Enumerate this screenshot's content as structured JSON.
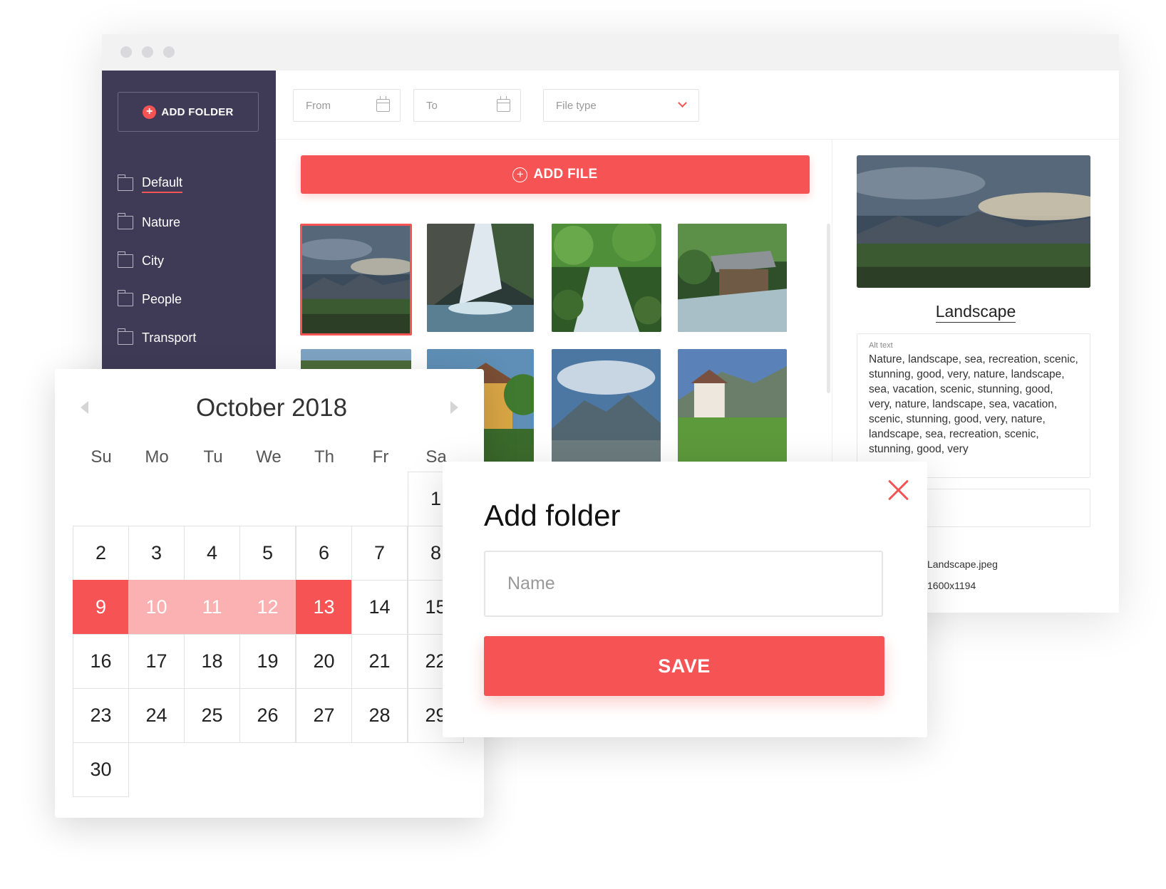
{
  "sidebar": {
    "add_folder_label": "ADD FOLDER",
    "folders": [
      {
        "label": "Default",
        "active": true
      },
      {
        "label": "Nature",
        "active": false
      },
      {
        "label": "City",
        "active": false
      },
      {
        "label": "People",
        "active": false
      },
      {
        "label": "Transport",
        "active": false
      }
    ]
  },
  "filters": {
    "from_placeholder": "From",
    "to_placeholder": "To",
    "file_type_placeholder": "File type"
  },
  "main": {
    "add_file_label": "ADD FILE"
  },
  "details": {
    "title": "Landscape",
    "alt_label": "Alt text",
    "alt_text": "Nature, landscape, sea, recreation, scenic, stunning, good, very, nature, landscape, sea, vacation, scenic, stunning, good, very, nature, landscape, sea, vacation, scenic, stunning, good, very, nature, landscape, sea, recreation, scenic, stunning, good, very",
    "file_name": "Landscape.jpeg",
    "dimensions": "1600x1194"
  },
  "calendar": {
    "title": "October 2018",
    "weekdays": [
      "Su",
      "Mo",
      "Tu",
      "We",
      "Th",
      "Fr",
      "Sa"
    ],
    "days": [
      "1",
      "2",
      "3",
      "4",
      "5",
      "6",
      "7",
      "8",
      "9",
      "10",
      "11",
      "12",
      "13",
      "14",
      "15",
      "16",
      "17",
      "18",
      "19",
      "20",
      "21",
      "22",
      "23",
      "24",
      "25",
      "26",
      "27",
      "28",
      "29",
      "30"
    ],
    "range_start": "9",
    "range_end": "13"
  },
  "modal": {
    "title": "Add folder",
    "name_placeholder": "Name",
    "save_label": "SAVE"
  },
  "colors": {
    "accent": "#f55354",
    "accent_light": "#fbb1b2",
    "sidebar_bg": "#3f3b57"
  },
  "icons": {
    "add_folder": "plus-circle-icon",
    "folder": "folder-icon",
    "date": "calendar-icon",
    "dropdown": "chevron-down-icon",
    "add_file": "plus-circle-outline-icon",
    "prev_month": "arrow-left-icon",
    "next_month": "arrow-right-icon",
    "close": "close-icon"
  }
}
